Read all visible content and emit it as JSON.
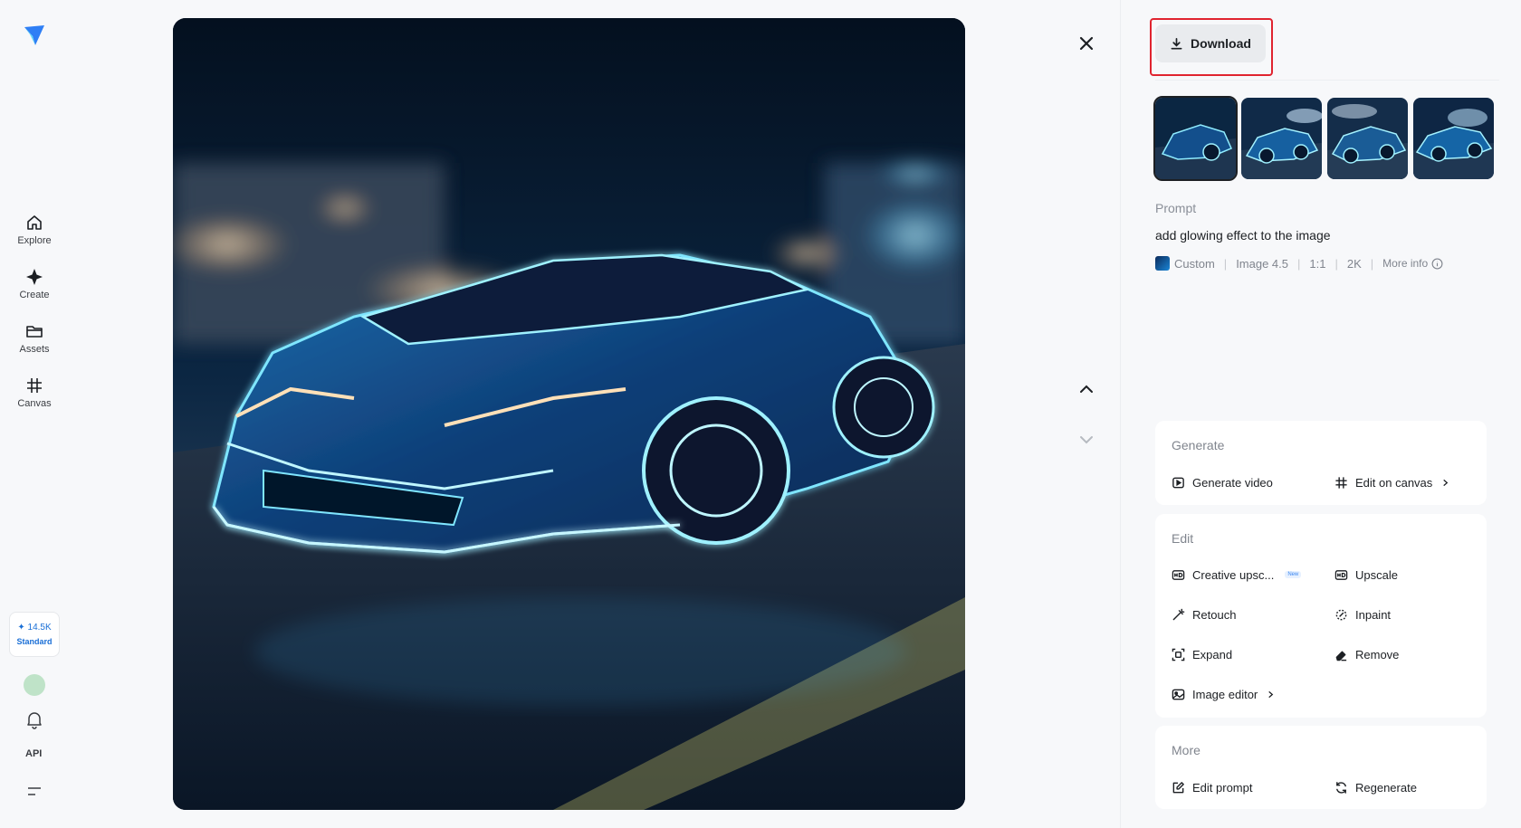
{
  "sidebar": {
    "items": [
      {
        "label": "Explore",
        "icon": "home-icon"
      },
      {
        "label": "Create",
        "icon": "sparkle-icon"
      },
      {
        "label": "Assets",
        "icon": "folder-icon"
      },
      {
        "label": "Canvas",
        "icon": "canvas-icon"
      }
    ],
    "credits": "14.5K",
    "plan": "Standard",
    "api_label": "API"
  },
  "panel": {
    "download_label": "Download",
    "prompt_label": "Prompt",
    "prompt_text": "add glowing effect to the image",
    "meta": {
      "model_name": "Custom",
      "model_version": "Image 4.5",
      "ratio": "1:1",
      "resolution": "2K",
      "more_info": "More info"
    },
    "generate": {
      "title": "Generate",
      "generate_video": "Generate video",
      "edit_on_canvas": "Edit on canvas"
    },
    "edit": {
      "title": "Edit",
      "creative_upscale": "Creative upsc...",
      "new_badge": "New",
      "upscale": "Upscale",
      "retouch": "Retouch",
      "inpaint": "Inpaint",
      "expand": "Expand",
      "remove": "Remove",
      "image_editor": "Image editor"
    },
    "more": {
      "title": "More",
      "edit_prompt": "Edit prompt",
      "regenerate": "Regenerate"
    }
  },
  "colors": {
    "accent": "#1a6fd6",
    "highlight": "#e0242f",
    "glow": "#4fd4ff"
  }
}
